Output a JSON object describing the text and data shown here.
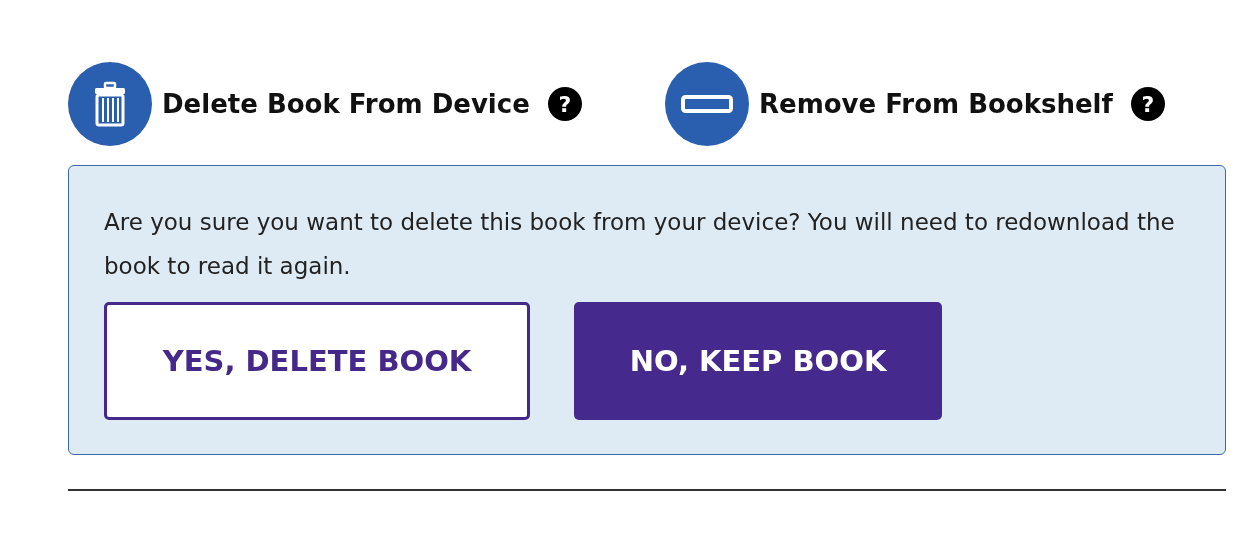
{
  "actions": [
    {
      "kind": "trash",
      "label": "Delete Book From Device",
      "help": "?"
    },
    {
      "kind": "remove",
      "label": "Remove From Bookshelf",
      "help": "?"
    }
  ],
  "confirm": {
    "message": "Are you sure you want to delete this book from your device? You will need to redownload the book to read it again.",
    "buttons": [
      {
        "kind": "outline",
        "label": "YES, DELETE BOOK"
      },
      {
        "kind": "filled",
        "label": "NO, KEEP BOOK"
      }
    ]
  }
}
